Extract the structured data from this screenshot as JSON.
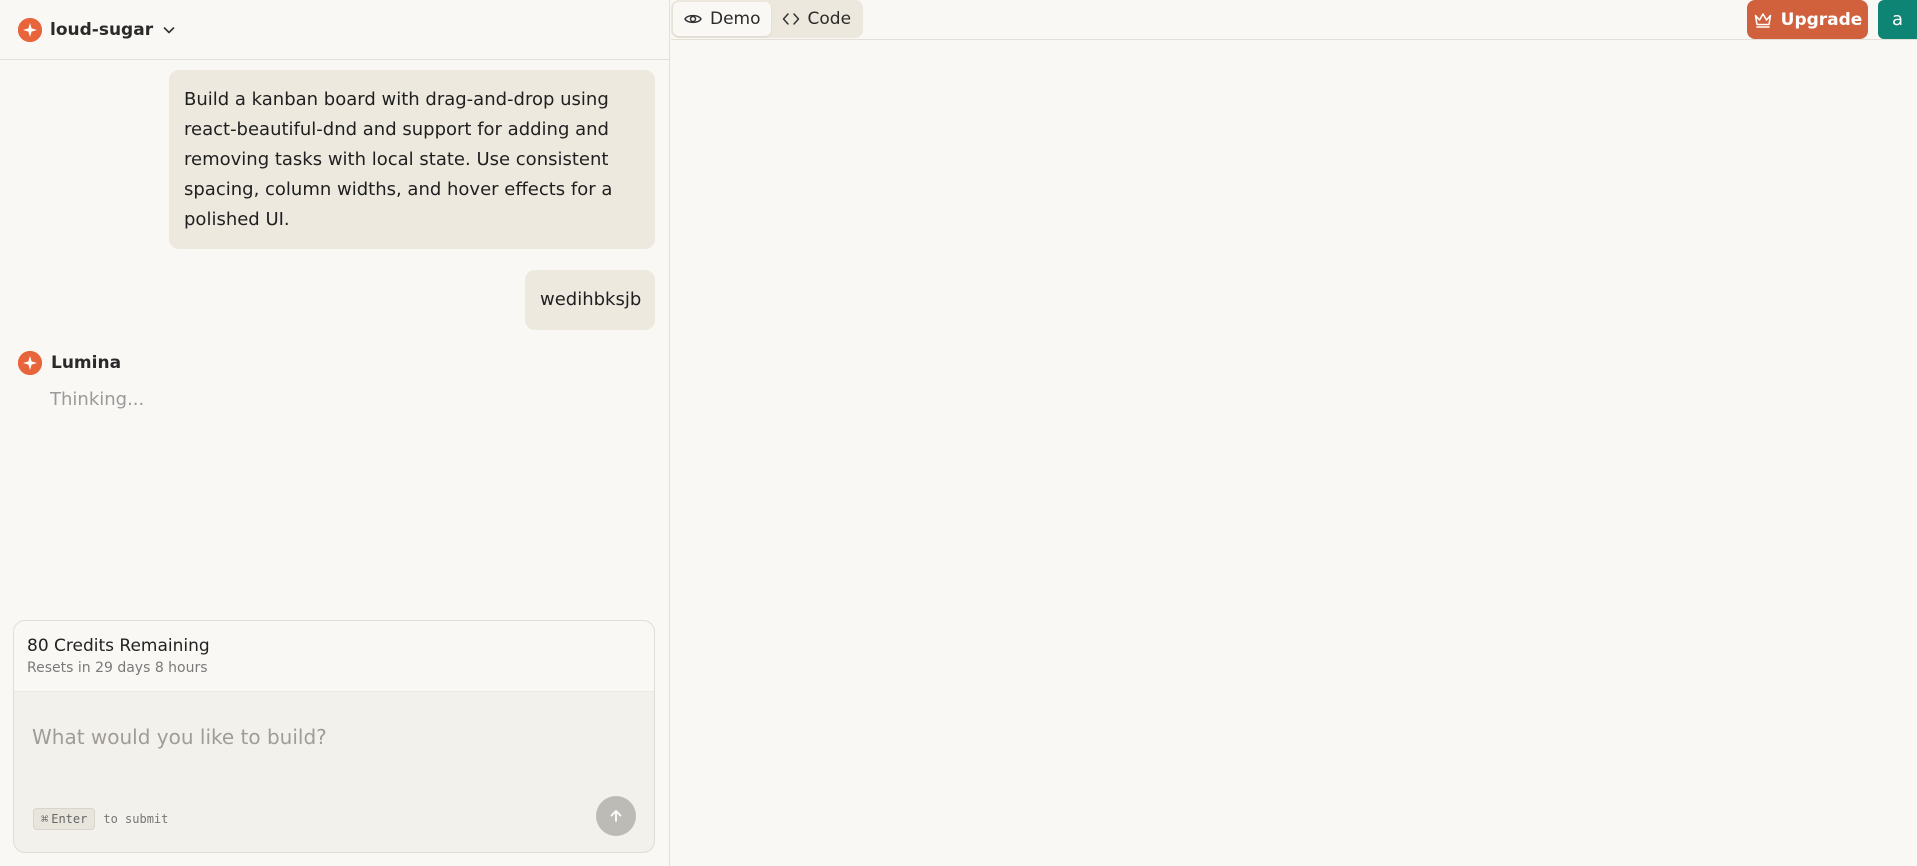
{
  "project": {
    "name": "loud-sugar"
  },
  "chat": {
    "messages": [
      {
        "role": "user",
        "text": "Build a kanban board with drag-and-drop using react-beautiful-dnd and support for adding and removing tasks with local state. Use consistent spacing, column widths, and hover effects for a polished UI."
      },
      {
        "role": "user",
        "text": "wedihbksjb"
      }
    ],
    "assistant": {
      "name": "Lumina",
      "status": "Thinking..."
    }
  },
  "credits": {
    "title": "80 Credits Remaining",
    "subtitle": "Resets in 29 days 8 hours"
  },
  "composer": {
    "placeholder": "What would you like to build?",
    "shortcut_key": "Enter",
    "shortcut_hint": "to submit"
  },
  "toolbar": {
    "tabs": [
      {
        "label": "Demo",
        "icon": "eye-icon",
        "active": true
      },
      {
        "label": "Code",
        "icon": "code-icon",
        "active": false
      }
    ],
    "upgrade_label": "Upgrade",
    "avatar_initial": "a"
  },
  "colors": {
    "brand": "#e8643a",
    "upgrade": "#d1613d",
    "avatar": "#0d8474",
    "background": "#faf8f4",
    "bubble": "#ede9df"
  }
}
